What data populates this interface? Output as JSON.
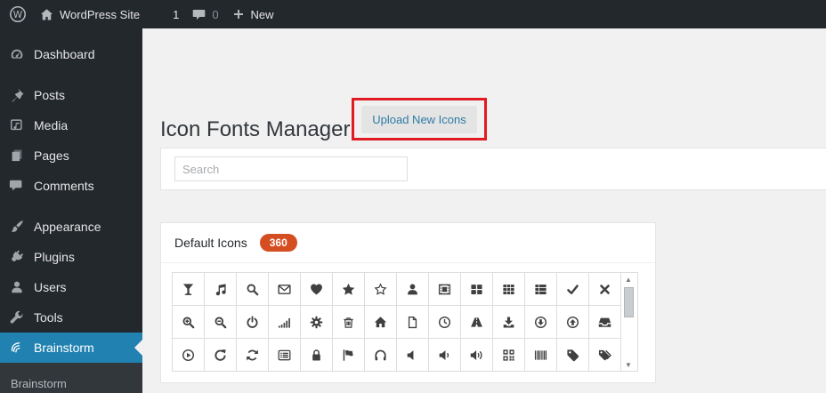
{
  "admin_bar": {
    "site_name": "WordPress Site",
    "update_count": "1",
    "comment_count": "0",
    "new_label": "New"
  },
  "sidebar": {
    "items": [
      {
        "label": "Dashboard",
        "icon": "dashboard",
        "active": false,
        "gap_after": true
      },
      {
        "label": "Posts",
        "icon": "pushpin",
        "active": false,
        "gap_after": false
      },
      {
        "label": "Media",
        "icon": "media",
        "active": false,
        "gap_after": false
      },
      {
        "label": "Pages",
        "icon": "pages",
        "active": false,
        "gap_after": false
      },
      {
        "label": "Comments",
        "icon": "comments",
        "active": false,
        "gap_after": true
      },
      {
        "label": "Appearance",
        "icon": "appearance",
        "active": false,
        "gap_after": false
      },
      {
        "label": "Plugins",
        "icon": "plugin",
        "active": false,
        "gap_after": false
      },
      {
        "label": "Users",
        "icon": "users",
        "active": false,
        "gap_after": false
      },
      {
        "label": "Tools",
        "icon": "tools",
        "active": false,
        "gap_after": false
      },
      {
        "label": "Brainstorm",
        "icon": "brainstorm",
        "active": true,
        "gap_after": false
      }
    ],
    "submenu": [
      "Brainstorm"
    ]
  },
  "main": {
    "page_title": "Icon Fonts Manager",
    "upload_button_label": "Upload New Icons",
    "search_placeholder": "Search",
    "panel": {
      "title": "Default Icons",
      "count": "360",
      "icons": [
        "glass",
        "music",
        "search",
        "envelope-o",
        "heart",
        "star",
        "star-o",
        "user",
        "film",
        "th-large",
        "th",
        "th-list",
        "check",
        "times",
        "search-plus",
        "search-minus",
        "power-off",
        "signal",
        "cog",
        "trash-o",
        "home",
        "file-o",
        "clock-o",
        "road",
        "download",
        "arrow-circle-down",
        "arrow-circle-up",
        "inbox",
        "play-circle-o",
        "repeat",
        "refresh",
        "list-alt",
        "lock",
        "flag",
        "headphones",
        "volume-off",
        "volume-down",
        "volume-up",
        "qrcode",
        "barcode",
        "tag",
        "tags"
      ]
    }
  },
  "scrollbar": {
    "up_glyph": "▲",
    "down_glyph": "▼"
  },
  "colors": {
    "chrome_bg": "#23282d",
    "content_bg": "#f1f1f1",
    "active_blue": "#2181b0",
    "highlight_red": "#e01b24",
    "badge_orange": "#d54e21",
    "link_blue": "#2d7ba3"
  }
}
